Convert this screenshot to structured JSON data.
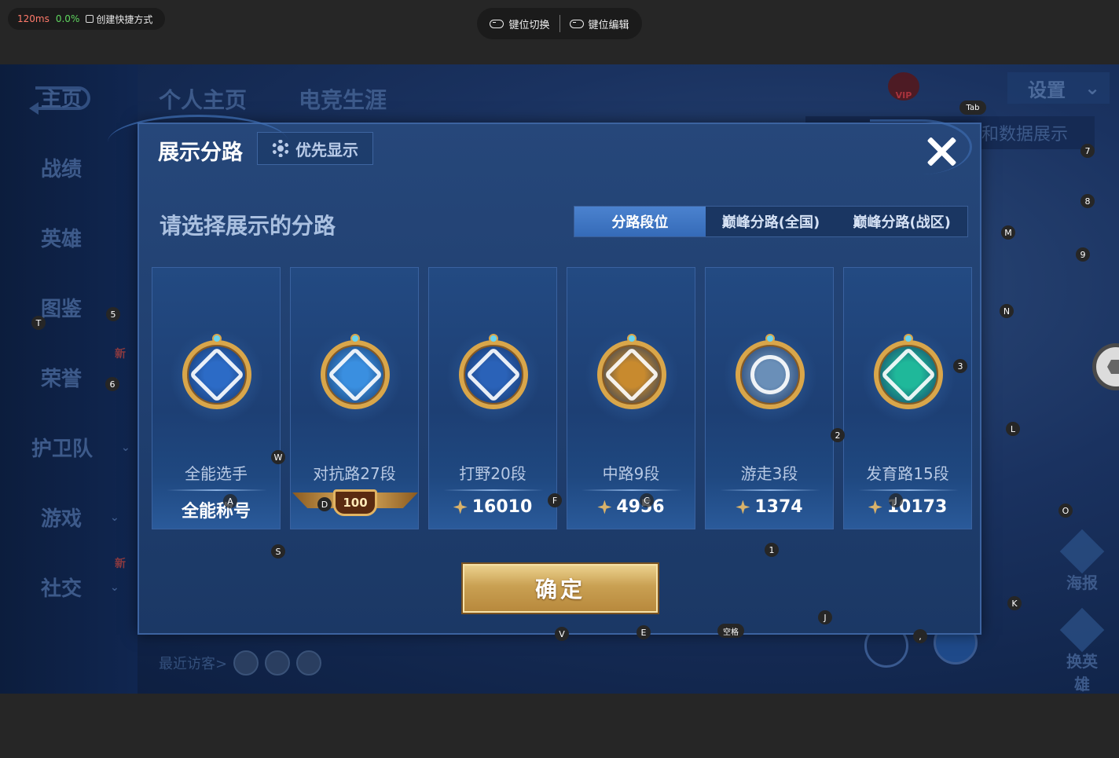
{
  "emulator": {
    "latency": "120ms",
    "loss": "0.0%",
    "shortcut_label": "创建快捷方式",
    "key_switch_label": "键位切换",
    "key_edit_label": "键位编辑"
  },
  "background": {
    "tabs": [
      "个人主页",
      "电竞生涯"
    ],
    "sidebar": [
      {
        "label": "主页",
        "chevron": false,
        "new": false
      },
      {
        "label": "战绩",
        "chevron": false,
        "new": false
      },
      {
        "label": "英雄",
        "chevron": false,
        "new": false
      },
      {
        "label": "图鉴",
        "chevron": false,
        "new": false
      },
      {
        "label": "荣誉",
        "chevron": true,
        "new": true
      },
      {
        "label": "护卫队",
        "chevron": true,
        "new": false
      },
      {
        "label": "游戏",
        "chevron": true,
        "new": false
      },
      {
        "label": "社交",
        "chevron": true,
        "new": true
      }
    ],
    "new_label": "新",
    "vip_label": "VIP",
    "settings_label": "设置",
    "data_show_label": "和数据展示",
    "recent_visitors": "最近访客>",
    "poster_label": "海报",
    "switch_hero_label": "换英雄"
  },
  "dialog": {
    "title": "展示分路",
    "priority_label": "优先显示",
    "subtitle": "请选择展示的分路",
    "tabs": [
      {
        "label": "分路段位",
        "active": true
      },
      {
        "label": "巅峰分路(全国)",
        "active": false
      },
      {
        "label": "巅峰分路(战区)",
        "active": false
      }
    ],
    "cards": [
      {
        "lane": "全能选手",
        "score": "全能称号",
        "icon": "all-round-emblem-icon",
        "color": "#2c6bc6",
        "has_score_icon": false
      },
      {
        "lane": "对抗路27段",
        "score": "100",
        "icon": "clash-lane-emblem-icon",
        "color": "#3a8fe0",
        "cap": true
      },
      {
        "lane": "打野20段",
        "score": "16010",
        "icon": "jungle-emblem-icon",
        "color": "#2a62b8",
        "has_score_icon": true
      },
      {
        "lane": "中路9段",
        "score": "4956",
        "icon": "mid-lane-emblem-icon",
        "color": "#c88a2e",
        "has_score_icon": true
      },
      {
        "lane": "游走3段",
        "score": "1374",
        "icon": "roam-emblem-icon",
        "color": "#6a8fb8",
        "has_score_icon": true
      },
      {
        "lane": "发育路15段",
        "score": "10173",
        "icon": "farm-lane-emblem-icon",
        "color": "#1fb89a",
        "has_score_icon": true
      }
    ],
    "confirm_label": "确定"
  },
  "keymap": [
    {
      "key": "Tab"
    },
    {
      "key": "7"
    },
    {
      "key": "8"
    },
    {
      "key": "M"
    },
    {
      "key": "9"
    },
    {
      "key": "T"
    },
    {
      "key": "5"
    },
    {
      "key": "N"
    },
    {
      "key": "6"
    },
    {
      "key": "3"
    },
    {
      "key": "2"
    },
    {
      "key": "L"
    },
    {
      "key": "W"
    },
    {
      "key": "A"
    },
    {
      "key": "D"
    },
    {
      "key": "F"
    },
    {
      "key": "C"
    },
    {
      "key": "J"
    },
    {
      "key": "O"
    },
    {
      "key": "S"
    },
    {
      "key": "1"
    },
    {
      "key": "K"
    },
    {
      "key": "V"
    },
    {
      "key": "E"
    },
    {
      "key": "空格"
    },
    {
      "key": "J"
    },
    {
      "key": ","
    }
  ]
}
